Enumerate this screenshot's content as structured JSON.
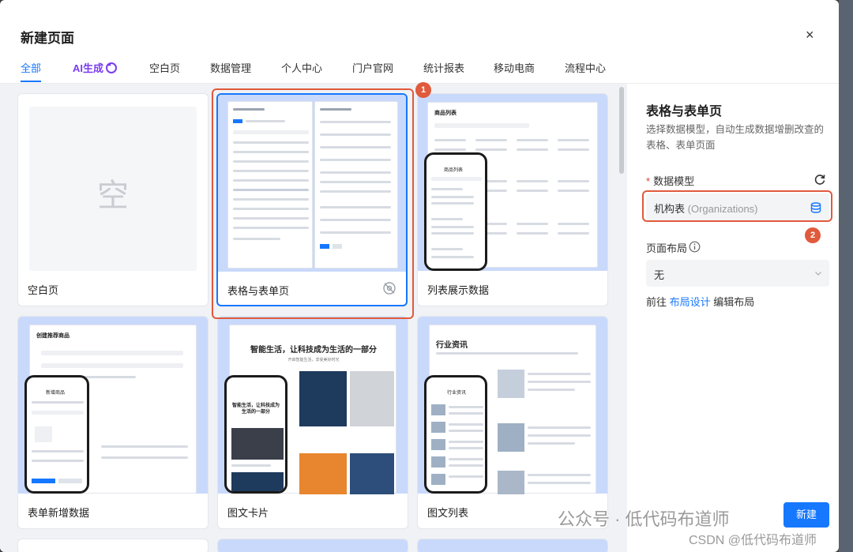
{
  "dialog": {
    "title": "新建页面",
    "close_glyph": "×"
  },
  "tabs": [
    {
      "label": "全部"
    },
    {
      "label": "AI生成"
    },
    {
      "label": "空白页"
    },
    {
      "label": "数据管理"
    },
    {
      "label": "个人中心"
    },
    {
      "label": "门户官网"
    },
    {
      "label": "统计报表"
    },
    {
      "label": "移动电商"
    },
    {
      "label": "流程中心"
    }
  ],
  "templates": [
    {
      "caption": "空白页",
      "placeholder": "空"
    },
    {
      "caption": "表格与表单页"
    },
    {
      "caption": "列表展示数据",
      "thumb_title": "商品列表",
      "phone_title": "商品列表"
    },
    {
      "caption": "表单新增数据",
      "thumb_title": "创建推荐商品",
      "phone_title": "新增商品"
    },
    {
      "caption": "图文卡片",
      "thumb_title": "智能生活，让科技成为生活的一部分",
      "thumb_sub": "开启智能生活，享受美好时光",
      "phone_title": "智能生活，让科技成为生活的一部分"
    },
    {
      "caption": "图文列表",
      "thumb_title": "行业资讯",
      "phone_title": "行业资讯"
    }
  ],
  "annotations": {
    "marker1": "1",
    "marker2": "2"
  },
  "panel": {
    "title": "表格与表单页",
    "description": "选择数据模型，自动生成数据增删改查的表格、表单页面",
    "model_label": "数据模型",
    "model_required": "*",
    "model_value": "机构表",
    "model_sub": "(Organizations)",
    "layout_label": "页面布局",
    "layout_value": "无",
    "goto_prefix": "前往",
    "goto_link": "布局设计",
    "goto_suffix": "编辑布局"
  },
  "footer": {
    "new_button": "新建"
  },
  "watermark": {
    "main": "公众号 · 低代码布道师",
    "sub": "CSDN @低代码布道师"
  },
  "colors": {
    "primary": "#1677ff",
    "ai": "#7a3cf0",
    "annotation": "#e05a3c",
    "thumb_bg": "#c9d9fb"
  }
}
